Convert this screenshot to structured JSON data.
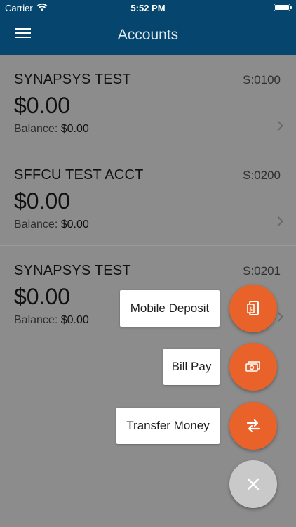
{
  "status_bar": {
    "carrier": "Carrier",
    "time": "5:52 PM"
  },
  "nav": {
    "title": "Accounts"
  },
  "accounts": [
    {
      "name": "SYNAPSYS TEST",
      "id": "S:0100",
      "amount": "$0.00",
      "balance_label": "Balance:",
      "balance_value": "$0.00"
    },
    {
      "name": "SFFCU TEST ACCT",
      "id": "S:0200",
      "amount": "$0.00",
      "balance_label": "Balance:",
      "balance_value": "$0.00"
    },
    {
      "name": "SYNAPSYS TEST",
      "id": "S:0201",
      "amount": "$0.00",
      "balance_label": "Balance:",
      "balance_value": "$0.00"
    }
  ],
  "fab_menu": {
    "actions": [
      {
        "label": "Mobile Deposit",
        "icon": "mobile-deposit-icon"
      },
      {
        "label": "Bill Pay",
        "icon": "bill-pay-icon"
      },
      {
        "label": "Transfer Money",
        "icon": "transfer-icon"
      }
    ],
    "close_icon": "close-icon"
  },
  "colors": {
    "nav_bar": "#06466e",
    "fab_action": "#e8622a",
    "fab_close": "#c9c9c9",
    "overlay_background": "#8c8c8c"
  }
}
